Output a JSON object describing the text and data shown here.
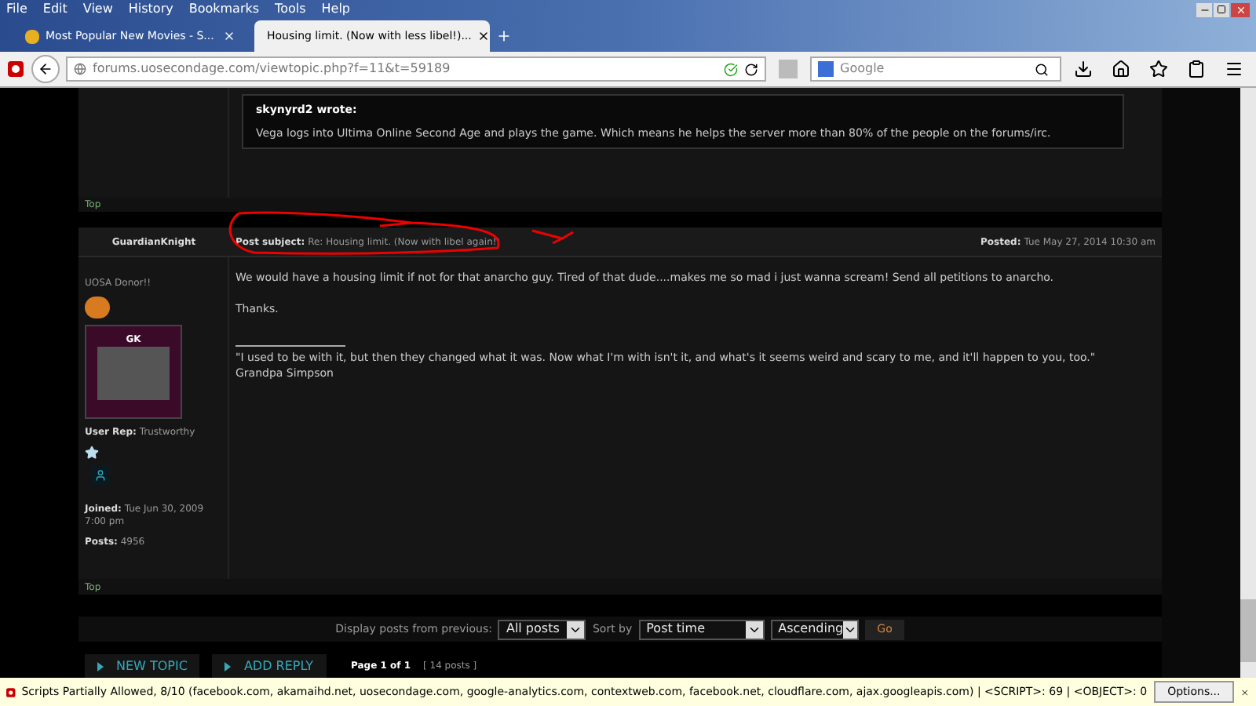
{
  "menu_bar": [
    "File",
    "Edit",
    "View",
    "History",
    "Bookmarks",
    "Tools",
    "Help"
  ],
  "tabs": [
    {
      "label": "Most Popular New Movies - S...",
      "selected": false
    },
    {
      "label": "Housing limit. (Now with less libel!)...",
      "selected": true
    }
  ],
  "address_bar": {
    "host": "forums.uosecondage.com",
    "path": "/viewtopic.php?f=11&t=59189"
  },
  "search": {
    "placeholder": "Google"
  },
  "quote": {
    "author": "skynyrd2 wrote:",
    "text": "Vega logs into Ultima Online Second Age and plays the game. Which means he helps the server more than 80% of the people on the forums/irc."
  },
  "top_links": [
    "Top",
    "Top"
  ],
  "post": {
    "author": "GuardianKnight",
    "subject_label": "Post subject:",
    "subject": "Re: Housing limit. (Now with libel again!)",
    "posted_label": "Posted:",
    "posted": "Tue May 27, 2014 10:30 am",
    "rank": "UOSA Donor!!",
    "avatar_caption": "GK",
    "rep_label": "User Rep:",
    "rep": "Trustworthy",
    "joined_label": "Joined:",
    "joined": "Tue Jun 30, 2009 7:00 pm",
    "posts_label": "Posts:",
    "posts": "4956",
    "body": [
      "We would have a housing limit if not for that anarcho guy. Tired of that dude....makes me so mad i just wanna scream! Send all petitions to anarcho.",
      "Thanks."
    ],
    "signature": "\"I used to be with it, but then they changed what it was. Now what I'm with isn't it, and what's it seems weird and scary to me, and it'll happen to you, too.\" Grandpa Simpson"
  },
  "sort_bar": {
    "display_label": "Display posts from previous:",
    "display": "All posts",
    "sort_label": "Sort by",
    "sort": "Post time",
    "order": "Ascending",
    "go": "Go"
  },
  "buttons": [
    "NEW TOPIC",
    "ADD REPLY"
  ],
  "pagination": {
    "page": "Page 1 of 1",
    "count": "[ 14 posts ]"
  },
  "notification": {
    "text": "Scripts Partially Allowed, 8/10 (facebook.com, akamaihd.net, uosecondage.com, google-analytics.com, contextweb.com, facebook.net, cloudflare.com, ajax.googleapis.com) | <SCRIPT>: 69 | <OBJECT>: 0",
    "button": "Options..."
  }
}
